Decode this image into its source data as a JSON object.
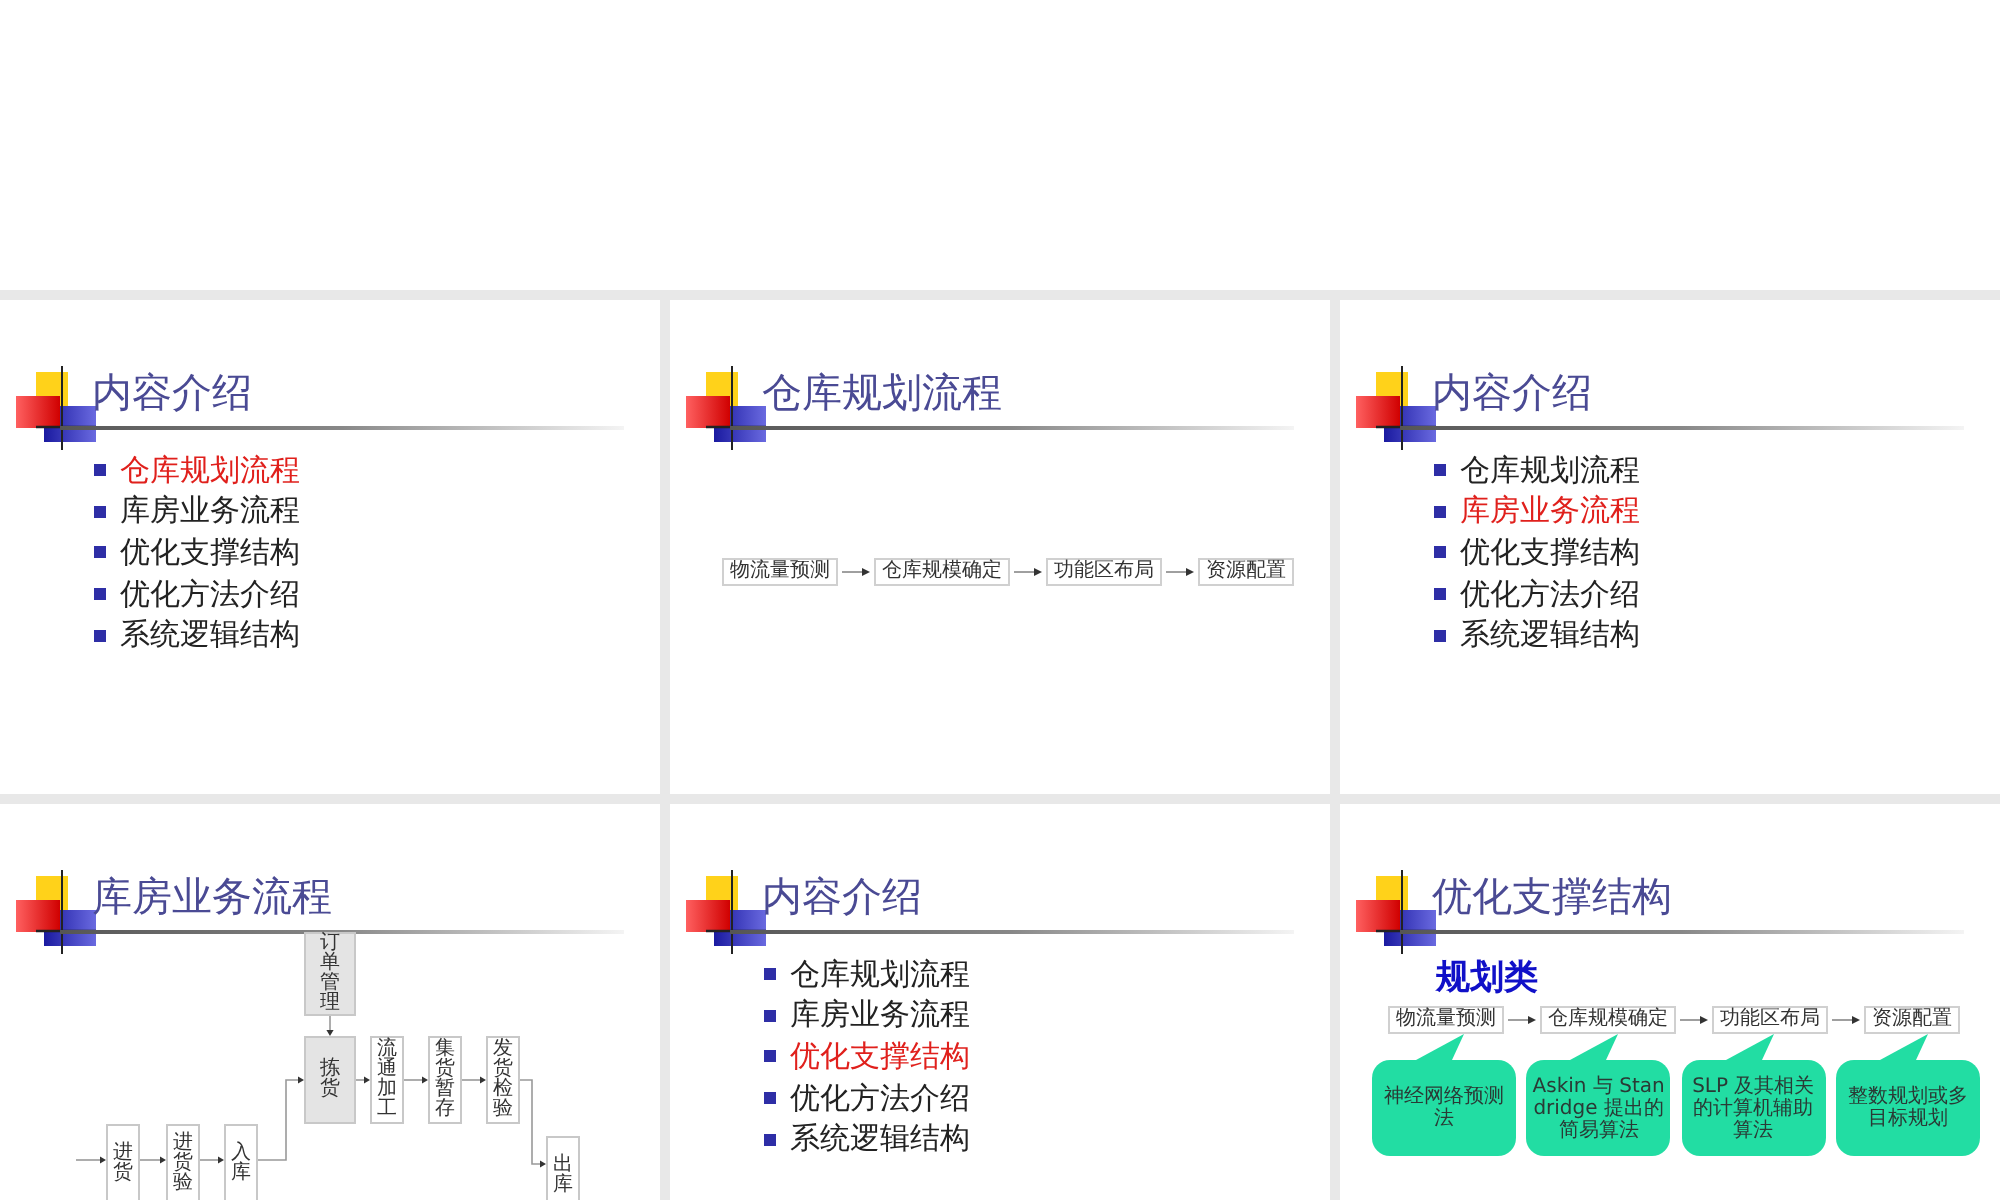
{
  "slides": [
    {
      "kind": "toc",
      "title": "内容介绍",
      "items": [
        {
          "text": "仓库规划流程",
          "selected": true
        },
        {
          "text": "库房业务流程",
          "selected": false
        },
        {
          "text": "优化支撑结构",
          "selected": false
        },
        {
          "text": "优化方法介绍",
          "selected": false
        },
        {
          "text": "系统逻辑结构",
          "selected": false
        }
      ]
    },
    {
      "kind": "flow",
      "title": "仓库规划流程",
      "steps": [
        "物流量预测",
        "仓库规模确定",
        "功能区布局",
        "资源配置"
      ]
    },
    {
      "kind": "toc",
      "title": "内容介绍",
      "items": [
        {
          "text": "仓库规划流程",
          "selected": false
        },
        {
          "text": "库房业务流程",
          "selected": true
        },
        {
          "text": "优化支撑结构",
          "selected": false
        },
        {
          "text": "优化方法介绍",
          "selected": false
        },
        {
          "text": "系统逻辑结构",
          "selected": false
        }
      ]
    },
    {
      "kind": "process",
      "title": "库房业务流程",
      "nodes": [
        {
          "label": "订单管理",
          "shaded": true
        },
        {
          "label": "拣货",
          "shaded": true
        },
        {
          "label": "流通加工",
          "shaded": false
        },
        {
          "label": "集货暂存",
          "shaded": false
        },
        {
          "label": "发货检验",
          "shaded": false
        },
        {
          "label": "进货",
          "shaded": false
        },
        {
          "label": "进货验",
          "shaded": false
        },
        {
          "label": "入库",
          "shaded": false
        },
        {
          "label": "出库",
          "shaded": false
        }
      ]
    },
    {
      "kind": "toc",
      "title": "内容介绍",
      "items": [
        {
          "text": "仓库规划流程",
          "selected": false
        },
        {
          "text": "库房业务流程",
          "selected": false
        },
        {
          "text": "优化支撑结构",
          "selected": true
        },
        {
          "text": "优化方法介绍",
          "selected": false
        },
        {
          "text": "系统逻辑结构",
          "selected": false
        }
      ]
    },
    {
      "kind": "structure",
      "title": "优化支撑结构",
      "subtitle": "规划类",
      "steps": [
        "物流量预测",
        "仓库规模确定",
        "功能区布局",
        "资源配置"
      ],
      "methods": [
        "神经网络预测法",
        "Askin 与 Standridge 提出的简易算法",
        "SLP 及其相关的计算机辅助算法",
        "整数规划或多目标规划"
      ]
    }
  ]
}
